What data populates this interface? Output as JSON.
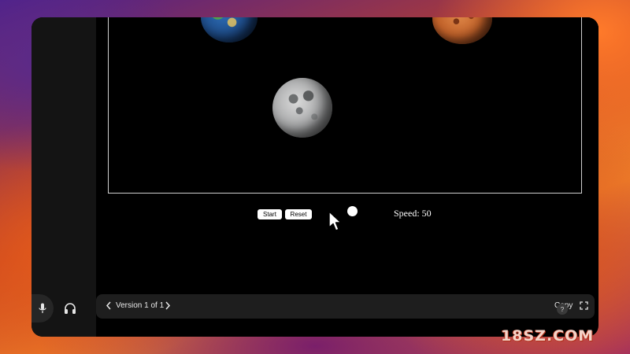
{
  "artifact": {
    "planets": [
      {
        "name": "earth",
        "icon": "earth-icon"
      },
      {
        "name": "mars",
        "icon": "mars-icon"
      },
      {
        "name": "moon",
        "icon": "moon-icon"
      }
    ],
    "controls": {
      "start_label": "Start",
      "reset_label": "Reset",
      "speed_label": "Speed: 50",
      "speed_value": 50
    }
  },
  "bottom_bar": {
    "version_label": "Version 1 of 1",
    "copy_label": "Copy"
  },
  "help": {
    "label": "?"
  },
  "watermark": {
    "text": "18SZ.COM"
  },
  "icons": {
    "mic": "microphone-icon",
    "headphones": "headphones-icon",
    "prev": "chevron-left-icon",
    "next": "chevron-right-icon",
    "expand": "expand-icon",
    "cursor": "mouse-pointer-icon"
  },
  "colors": {
    "background": "#000000",
    "bottom_bar": "#1e1e1e",
    "button": "#ffffff"
  }
}
